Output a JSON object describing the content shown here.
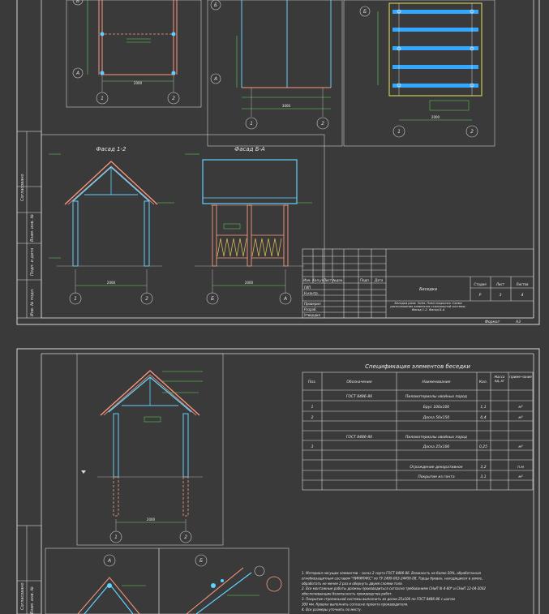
{
  "sheet1": {
    "facade_left_title": "Фасад 1-2",
    "facade_right_title": "Фасад Б-А",
    "grid_top_left": [
      "А",
      "Б",
      "1",
      "2"
    ],
    "grid_top_mid": [
      "Б",
      "А",
      "1",
      "2"
    ],
    "grid_top_right": [
      "Б",
      "1",
      "2"
    ],
    "grid_bottom_left": [
      "1",
      "2"
    ],
    "grid_bottom_right": [
      "Б",
      "А"
    ],
    "dims": {
      "d2000_a": "2000",
      "d2000_b": "2000",
      "d2000_c": "2000",
      "d2000_d": "2000",
      "d2000_e": "2000",
      "d3000": "3000"
    },
    "side_stamp": [
      "Согласовано",
      "Взам. инв. №",
      "Подп. и дата",
      "Инв. № подл."
    ],
    "title_block": {
      "header_cols": [
        "Изм.",
        "Кол.уч",
        "Лист",
        "№док.",
        "Подп.",
        "Дата"
      ],
      "roles": [
        "ГИП",
        "Н.контр.",
        "Проверил",
        "Разраб.",
        "Утвердил"
      ],
      "project": "Беседка",
      "stage_headers": [
        "Стадия",
        "Лист",
        "Листов"
      ],
      "stage_values": [
        "Р",
        "3",
        "4"
      ],
      "sheet_title": "Беседка разм. 3х3м. План покрытия. Схема расположения элементов стропильной системы. Фасад 1-2. Фасад Б-А",
      "format_label": "Формат",
      "format_value": "А3"
    }
  },
  "sheet2": {
    "spec_title": "Спецификация элементов беседки",
    "spec_headers": [
      "Поз.",
      "Обозначение",
      "Наименование",
      "Кол.",
      "Масса ед.,кг",
      "Приме-чание"
    ],
    "spec_rows": [
      [
        "",
        "ГОСТ 8486-86",
        "Пиломатериалы хвойных пород",
        "",
        "",
        ""
      ],
      [
        "1",
        "",
        "Брус 100х100",
        "1,1",
        "",
        "м³"
      ],
      [
        "2",
        "",
        "Доска 50х150",
        "0,4",
        "",
        "м³"
      ],
      [
        "",
        "",
        "",
        "",
        "",
        ""
      ],
      [
        "",
        "ГОСТ 8486-86",
        "Пиломатериалы хвойных пород",
        "",
        "",
        ""
      ],
      [
        "3",
        "",
        "Доска 25х100",
        "0,25",
        "",
        "м³"
      ],
      [
        "",
        "",
        "",
        "",
        "",
        ""
      ],
      [
        "",
        "",
        "Ограждение декоративное",
        "3,2",
        "",
        "п.м"
      ],
      [
        "",
        "",
        "Покрытие из гонта",
        "3,1",
        "",
        "м²"
      ]
    ],
    "grid_labels": [
      "1",
      "2",
      "А",
      "Б"
    ],
    "side_stamp": [
      "Согласовано",
      "Взам. инв. №"
    ],
    "notes": [
      "1. Материал несущих элементов – сосна 2 сорта ГОСТ 8486-86. Влажность не более 20%, обработанная",
      "огнебиозащитным составом \"ПИРИЛАКС\" по ТУ 2499-003-24456-08. Торцы бревен, находящиеся в земле,",
      "обработать не менее 2 раз и обернуть двумя слоями толя.",
      "2. Все монтажные работы должны производиться согласно требованиям СНиП III-4-80* и СНиП 12-04-2002",
      "обеспечивающие безопасность производства работ.",
      "3. Покрытие стропильной системы выполнить из доски 25х100 по ГОСТ 8486-86 с шагом",
      "300 мм. Кровлю выполнить согласно проекта производителя.",
      "4. Все размеры уточнить по месту."
    ]
  }
}
